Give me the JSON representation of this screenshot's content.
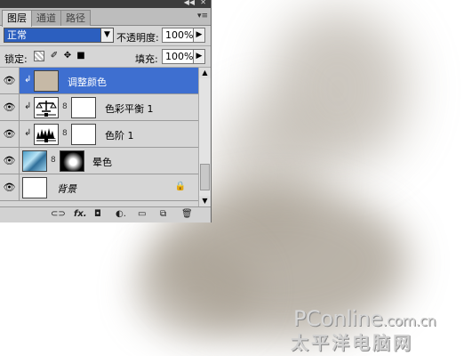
{
  "panel": {
    "tabs": [
      {
        "label": "图层",
        "active": true
      },
      {
        "label": "通道",
        "active": false
      },
      {
        "label": "路径",
        "active": false
      }
    ],
    "blend_mode": "正常",
    "opacity_label": "不透明度:",
    "opacity_value": "100%",
    "lock_label": "锁定:",
    "fill_label": "填充:",
    "fill_value": "100%"
  },
  "layers": [
    {
      "name": "调整颜色",
      "selected": true,
      "clipped": true,
      "thumb": "solid",
      "thumb_color": "#c6b9a6"
    },
    {
      "name": "色彩平衡 1",
      "selected": false,
      "clipped": true,
      "thumb": "balance-icon"
    },
    {
      "name": "色阶 1",
      "selected": false,
      "clipped": true,
      "thumb": "levels-icon"
    },
    {
      "name": "晕色",
      "selected": false,
      "clipped": false,
      "thumb": "image"
    },
    {
      "name": "背景",
      "selected": false,
      "clipped": false,
      "thumb": "white",
      "locked": true
    }
  ],
  "bottom_icons": [
    "link-icon",
    "fx-icon",
    "mask-icon",
    "adjustment-icon",
    "group-icon",
    "new-layer-icon",
    "trash-icon"
  ],
  "watermark": {
    "brand": "PConline",
    "domain": ".com.cn",
    "chinese": "太平洋电脑网"
  },
  "colors": {
    "selection": "#3e6fd0",
    "blend_box": "#2c5fbf",
    "panel_bg": "#d6d6d6"
  }
}
